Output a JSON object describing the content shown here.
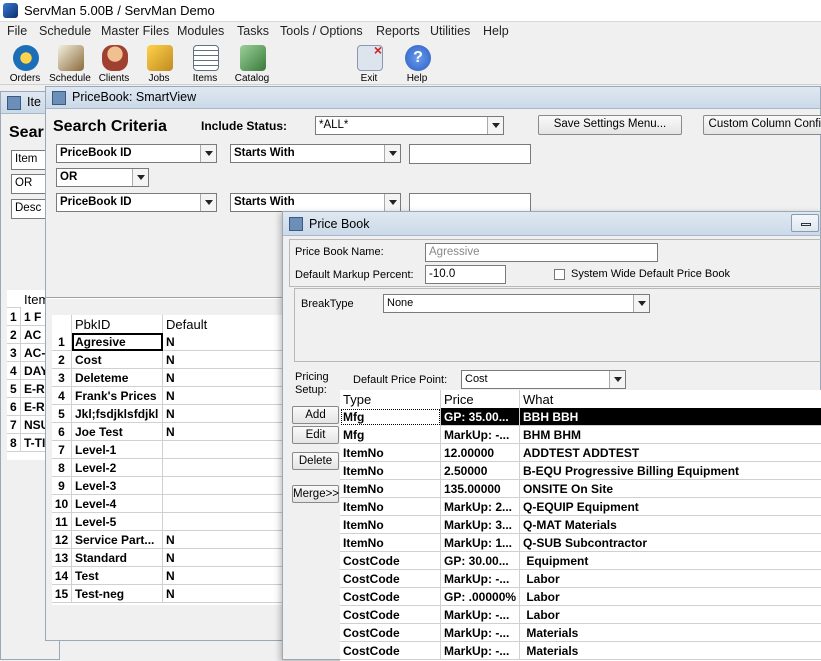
{
  "app": {
    "title": "ServMan 5.00B / ServMan Demo",
    "menus": [
      "File",
      "Schedule",
      "Master Files",
      "Modules",
      "Tasks",
      "Tools / Options",
      "Reports",
      "Utilities",
      "Help"
    ],
    "toolbar": [
      {
        "label": "Orders",
        "icon": "orders-icon",
        "color": "#1c6fb7"
      },
      {
        "label": "Schedule",
        "icon": "schedule-icon",
        "color": "#8a6a3a"
      },
      {
        "label": "Clients",
        "icon": "clients-icon",
        "color": "#a04030"
      },
      {
        "label": "Jobs",
        "icon": "jobs-icon",
        "color": "#c08a20"
      },
      {
        "label": "Items",
        "icon": "items-icon",
        "color": "#607080"
      },
      {
        "label": "Catalog",
        "icon": "catalog-icon",
        "color": "#3a7a3a"
      },
      {
        "label": "Exit",
        "icon": "exit-icon",
        "color": "#8898b0"
      },
      {
        "label": "Help",
        "icon": "help-icon",
        "color": "#2a5cc0"
      }
    ]
  },
  "items_window": {
    "title": "Ite",
    "heading": "Sear",
    "fields": [
      "Item",
      "OR",
      "Desc"
    ],
    "col_header": "Item",
    "rows": [
      {
        "n": "1",
        "v": "1 F"
      },
      {
        "n": "2",
        "v": "AC"
      },
      {
        "n": "3",
        "v": "AC-"
      },
      {
        "n": "4",
        "v": "DAY"
      },
      {
        "n": "5",
        "v": "E-R"
      },
      {
        "n": "6",
        "v": "E-R"
      },
      {
        "n": "7",
        "v": "NSU"
      },
      {
        "n": "8",
        "v": "T-TI"
      }
    ]
  },
  "smartview": {
    "title": "PriceBook: SmartView",
    "search_criteria": "Search Criteria",
    "include_status_label": "Include Status:",
    "include_status_value": "*ALL*",
    "save_settings": "Save Settings Menu...",
    "custom_columns": "Custom Column Config",
    "criteria": [
      {
        "field": "PriceBook ID",
        "op": "Starts With",
        "value": ""
      },
      {
        "field": "PriceBook ID",
        "op": "Starts With",
        "value": ""
      }
    ],
    "connector": "OR",
    "columns": [
      "PbkID",
      "Default"
    ],
    "rows": [
      {
        "n": "1",
        "id": "Agresive",
        "def": "N"
      },
      {
        "n": "2",
        "id": "Cost",
        "def": "N"
      },
      {
        "n": "3",
        "id": "Deleteme",
        "def": "N"
      },
      {
        "n": "4",
        "id": "Frank's Prices",
        "def": "N"
      },
      {
        "n": "5",
        "id": "Jkl;fsdjklsfdjkl",
        "def": "N"
      },
      {
        "n": "6",
        "id": "Joe Test",
        "def": "N"
      },
      {
        "n": "7",
        "id": "Level-1",
        "def": ""
      },
      {
        "n": "8",
        "id": "Level-2",
        "def": ""
      },
      {
        "n": "9",
        "id": "Level-3",
        "def": ""
      },
      {
        "n": "10",
        "id": "Level-4",
        "def": ""
      },
      {
        "n": "11",
        "id": "Level-5",
        "def": ""
      },
      {
        "n": "12",
        "id": "Service Part...",
        "def": "N"
      },
      {
        "n": "13",
        "id": "Standard",
        "def": "N"
      },
      {
        "n": "14",
        "id": "Test",
        "def": "N"
      },
      {
        "n": "15",
        "id": "Test-neg",
        "def": "N"
      }
    ]
  },
  "price_book": {
    "title": "Price Book",
    "name_label": "Price Book Name:",
    "name_value": "Agressive",
    "markup_label": "Default Markup Percent:",
    "markup_value": "-10.0",
    "system_default_label": "System Wide Default Price Book",
    "system_default_checked": false,
    "breaktype_label": "BreakType",
    "breaktype_value": "None",
    "pricing_setup_label": "Pricing Setup:",
    "default_price_point_label": "Default Price Point:",
    "default_price_point_value": "Cost",
    "buttons": [
      "Add",
      "Edit",
      "Delete",
      "Merge>>"
    ],
    "columns": [
      "Type",
      "Price",
      "What"
    ],
    "rows": [
      {
        "type": "Mfg",
        "price": "GP: 35.00...",
        "what": "BBH BBH",
        "selected": true
      },
      {
        "type": "Mfg",
        "price": "MarkUp: -...",
        "what": "BHM BHM"
      },
      {
        "type": "ItemNo",
        "price": "12.00000",
        "what": "ADDTEST ADDTEST"
      },
      {
        "type": "ItemNo",
        "price": "2.50000",
        "what": "B-EQU Progressive Billing Equipment"
      },
      {
        "type": "ItemNo",
        "price": "135.00000",
        "what": "ONSITE On Site"
      },
      {
        "type": "ItemNo",
        "price": "MarkUp: 2...",
        "what": "Q-EQUIP Equipment"
      },
      {
        "type": "ItemNo",
        "price": "MarkUp: 3...",
        "what": "Q-MAT Materials"
      },
      {
        "type": "ItemNo",
        "price": "MarkUp: 1...",
        "what": "Q-SUB Subcontractor"
      },
      {
        "type": "CostCode",
        "price": "GP: 30.00...",
        "what": " Equipment"
      },
      {
        "type": "CostCode",
        "price": "MarkUp: -...",
        "what": " Labor"
      },
      {
        "type": "CostCode",
        "price": "GP: .00000%",
        "what": " Labor"
      },
      {
        "type": "CostCode",
        "price": "MarkUp: -...",
        "what": " Labor"
      },
      {
        "type": "CostCode",
        "price": "MarkUp: -...",
        "what": " Materials"
      },
      {
        "type": "CostCode",
        "price": "MarkUp: -...",
        "what": " Materials"
      }
    ]
  }
}
